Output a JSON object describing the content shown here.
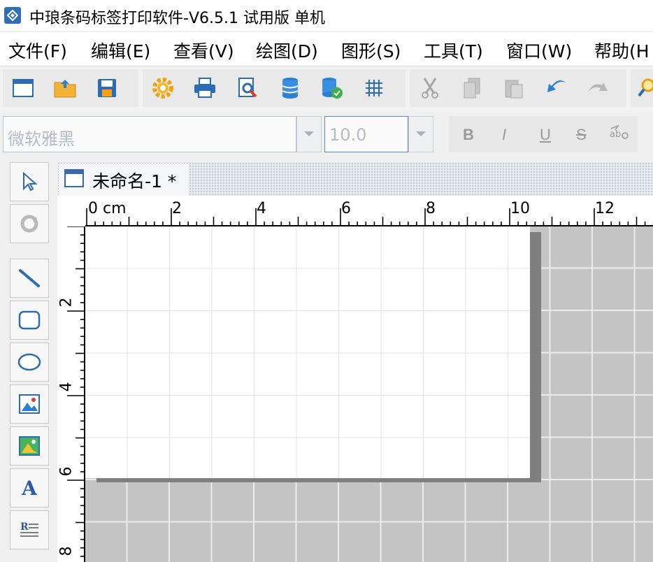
{
  "window": {
    "title": "中琅条码标签打印软件-V6.5.1 试用版 单机",
    "icon": "app-logo-icon"
  },
  "menu": [
    {
      "label": "文件(F)"
    },
    {
      "label": "编辑(E)"
    },
    {
      "label": "查看(V)"
    },
    {
      "label": "绘图(D)"
    },
    {
      "label": "图形(S)"
    },
    {
      "label": "工具(T)"
    },
    {
      "label": "窗口(W)"
    },
    {
      "label": "帮助(H"
    }
  ],
  "toolbar": {
    "buttons": [
      {
        "icon": "new-file-icon",
        "enabled": true
      },
      {
        "icon": "open-folder-icon",
        "enabled": true
      },
      {
        "icon": "save-icon",
        "enabled": true
      },
      {
        "icon": "settings-gear-icon",
        "enabled": true
      },
      {
        "icon": "printer-icon",
        "enabled": true
      },
      {
        "icon": "print-preview-icon",
        "enabled": true
      },
      {
        "icon": "database-icon",
        "enabled": true
      },
      {
        "icon": "database-settings-icon",
        "enabled": true
      },
      {
        "icon": "grid-icon",
        "enabled": true
      },
      {
        "icon": "cut-icon",
        "enabled": false
      },
      {
        "icon": "copy-icon",
        "enabled": false
      },
      {
        "icon": "paste-icon",
        "enabled": false
      },
      {
        "icon": "undo-icon",
        "enabled": true
      },
      {
        "icon": "redo-icon",
        "enabled": false
      },
      {
        "icon": "search-icon",
        "enabled": true
      }
    ]
  },
  "format": {
    "font_name": "微软雅黑",
    "font_size": "10.0",
    "bold": "B",
    "italic": "I",
    "underline": "U",
    "strike": "S"
  },
  "tools": [
    {
      "icon": "select-arrow-icon"
    },
    {
      "icon": "rotate-icon"
    },
    {
      "icon": "line-tool-icon"
    },
    {
      "icon": "rounded-rectangle-icon"
    },
    {
      "icon": "ellipse-icon"
    },
    {
      "icon": "image-icon"
    },
    {
      "icon": "picture-icon"
    },
    {
      "icon": "text-tool-icon",
      "glyph": "A"
    },
    {
      "icon": "rich-text-icon"
    }
  ],
  "document": {
    "tab_title": "未命名-1 *"
  },
  "ruler": {
    "unit": "cm",
    "top_labels": [
      "0 cm",
      "2",
      "4",
      "6",
      "8",
      "10",
      "12"
    ],
    "left_labels": [
      "2",
      "4",
      "6",
      "8"
    ]
  },
  "colors": {
    "canvas_bg": "#c4c4c4",
    "paper": "#ffffff",
    "shadow": "#7f7f7f",
    "accent": "#2f6fb5"
  }
}
